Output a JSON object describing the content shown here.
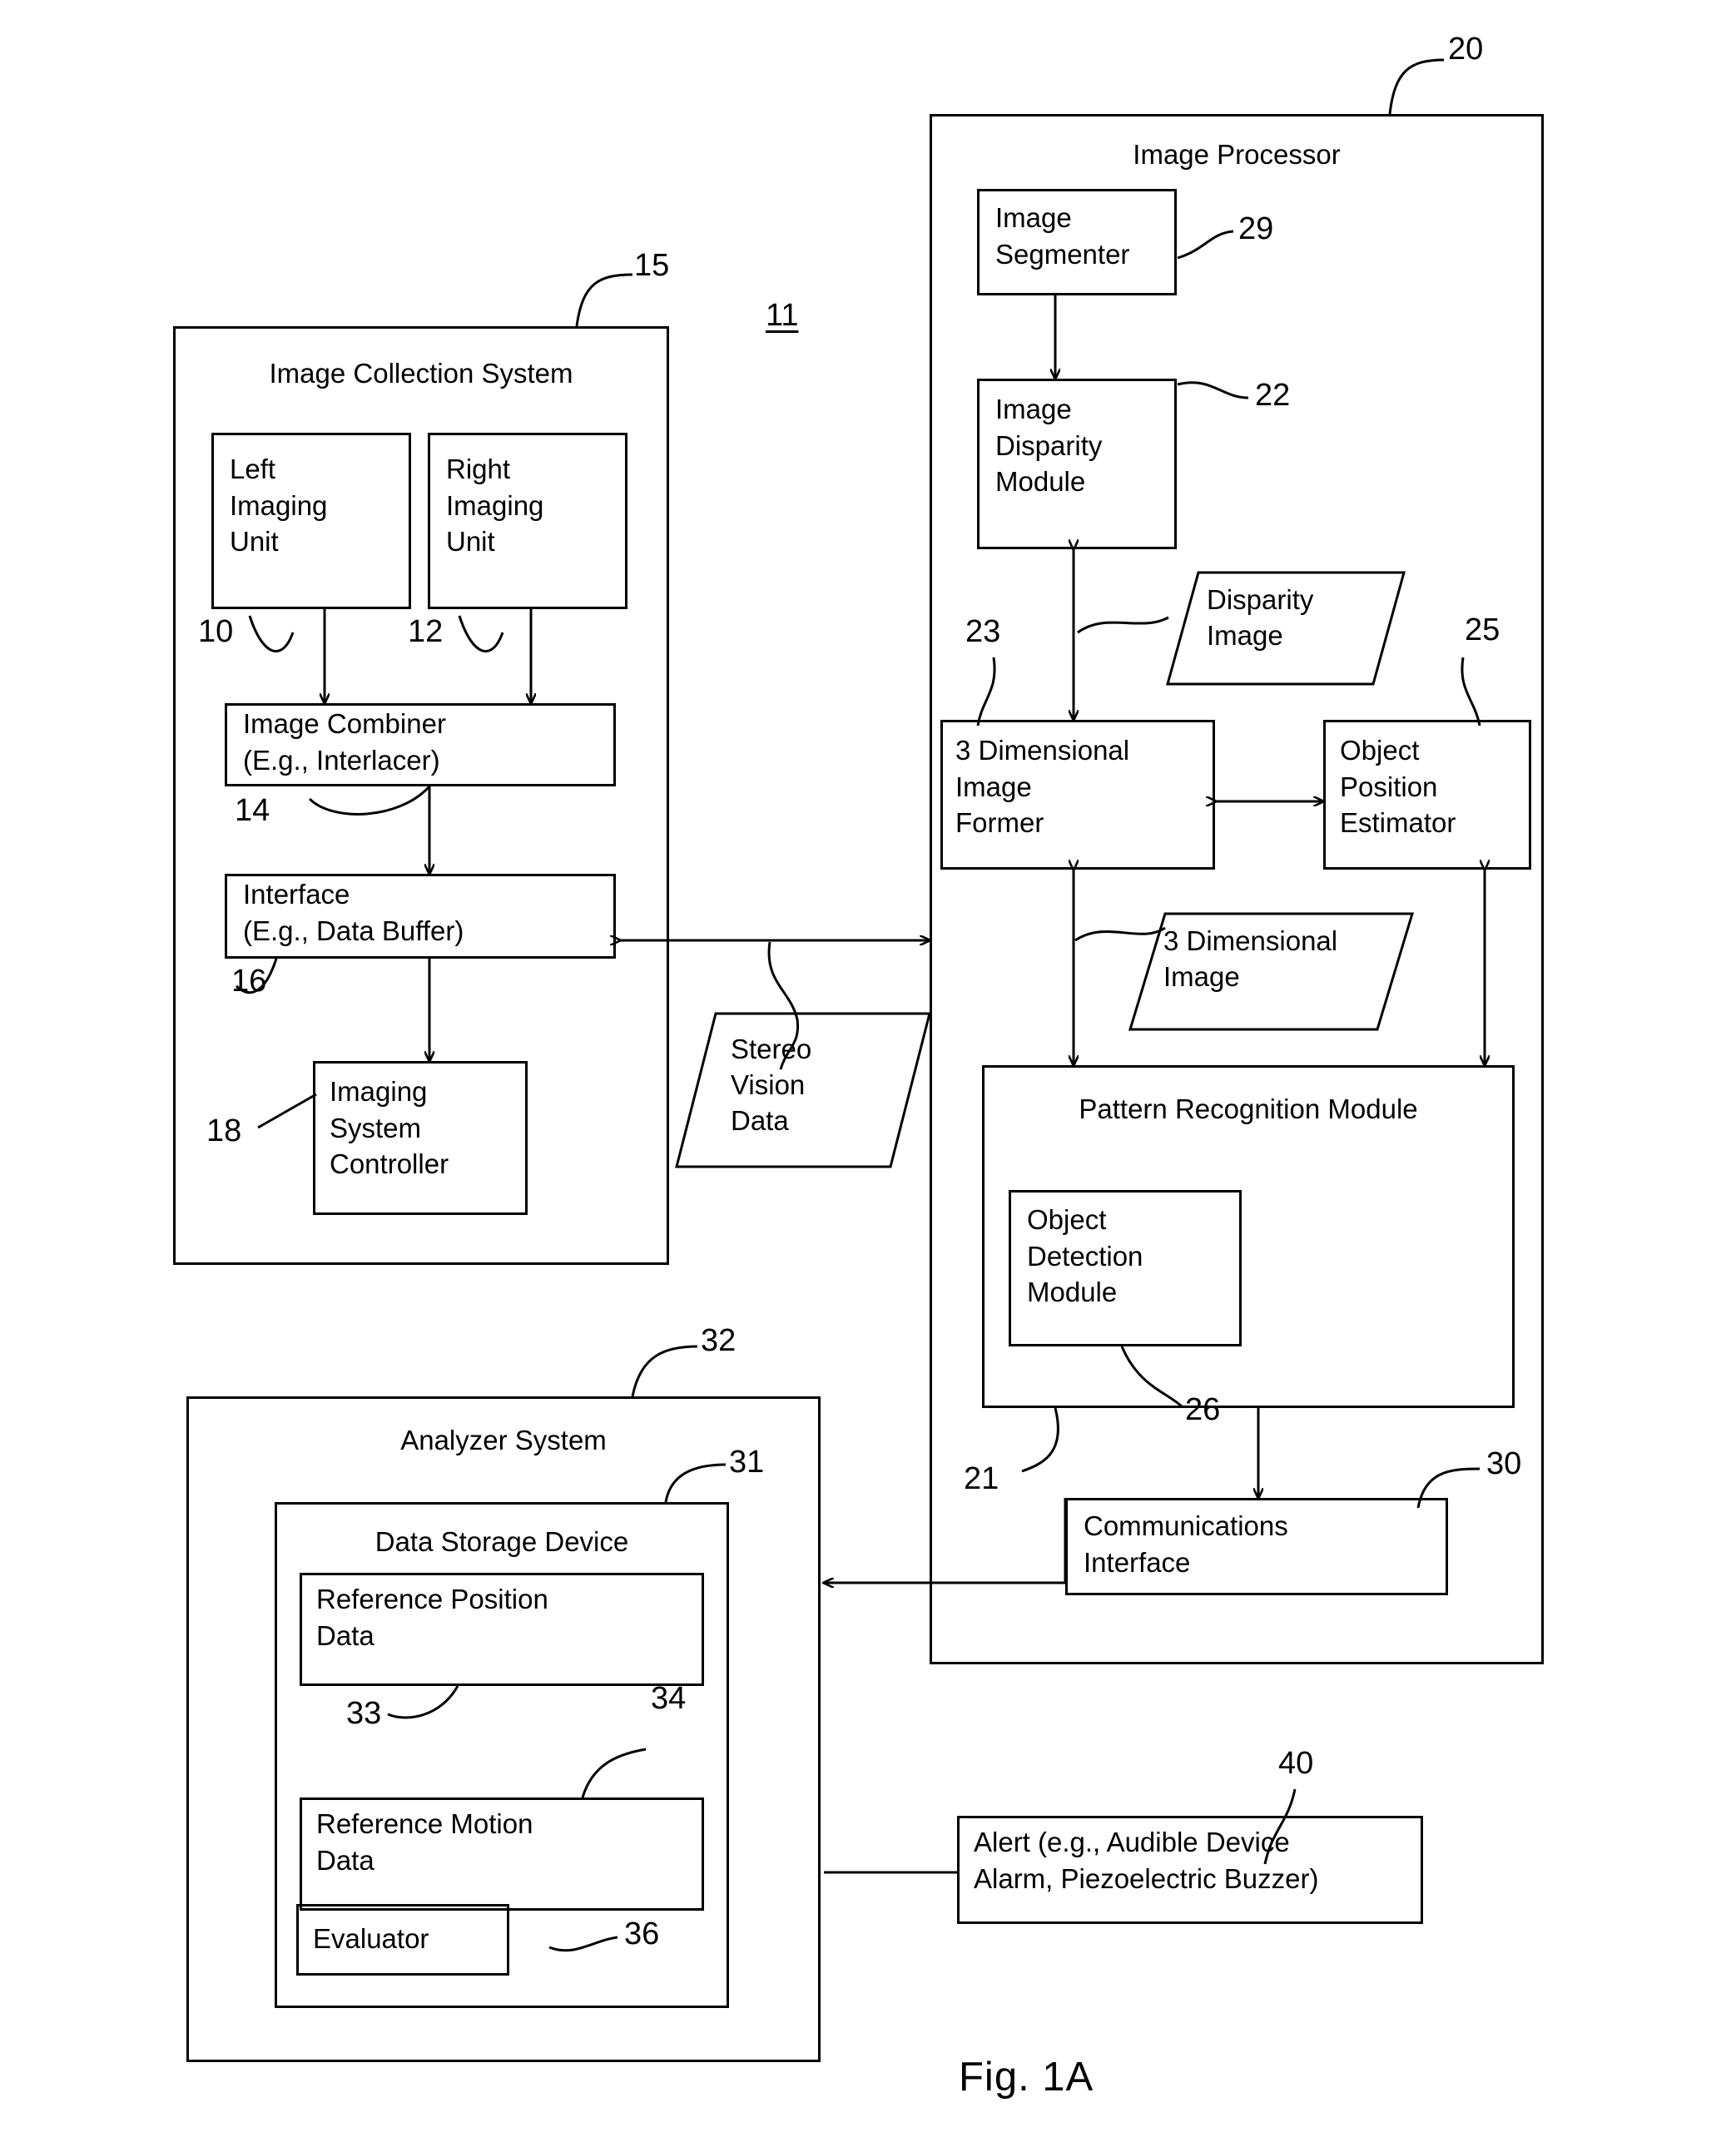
{
  "figure": {
    "caption": "Fig. 1A",
    "system_ref": "11"
  },
  "image_collection_system": {
    "title": "Image Collection System",
    "ref": "15",
    "blocks": [
      {
        "label": "Left\nImaging\nUnit",
        "ref": "10"
      },
      {
        "label": "Right\nImaging\nUnit",
        "ref": "12"
      },
      {
        "label": "Image Combiner\n(E.g., Interlacer)",
        "ref": "14"
      },
      {
        "label": "Interface\n(E.g., Data Buffer)",
        "ref": "16"
      },
      {
        "label": "Imaging\nSystem\nController",
        "ref": "18"
      }
    ]
  },
  "stereo_vision_data": {
    "label": "Stereo\nVision\nData"
  },
  "image_processor": {
    "title": "Image Processor",
    "ref": "20",
    "blocks": [
      {
        "label": "Image\nSegmenter",
        "ref": "29"
      },
      {
        "label": "Image\nDisparity\nModule",
        "ref": "22"
      },
      {
        "label": "3 Dimensional\nImage\nFormer",
        "ref": "23"
      },
      {
        "label": "Object\nPosition\nEstimator",
        "ref": "25"
      },
      {
        "label": "Pattern Recognition Module",
        "ref": "21"
      },
      {
        "label": "Object\nDetection\nModule",
        "ref": "26"
      },
      {
        "label": "Communications\nInterface",
        "ref": "30"
      }
    ],
    "data_objects": [
      {
        "label": "Disparity\nImage"
      },
      {
        "label": "3 Dimensional\nImage"
      }
    ]
  },
  "analyzer_system": {
    "title": "Analyzer System",
    "ref": "32",
    "data_storage_device": {
      "title": "Data Storage Device",
      "ref": "31",
      "blocks": [
        {
          "label": "Reference Position\nData",
          "ref": "33"
        },
        {
          "label": "Reference Motion\nData",
          "ref": "34"
        }
      ]
    },
    "evaluator": {
      "label": "Evaluator",
      "ref": "36"
    }
  },
  "alert": {
    "label": "Alert (e.g., Audible Device\nAlarm, Piezoelectric Buzzer)",
    "ref": "40"
  }
}
